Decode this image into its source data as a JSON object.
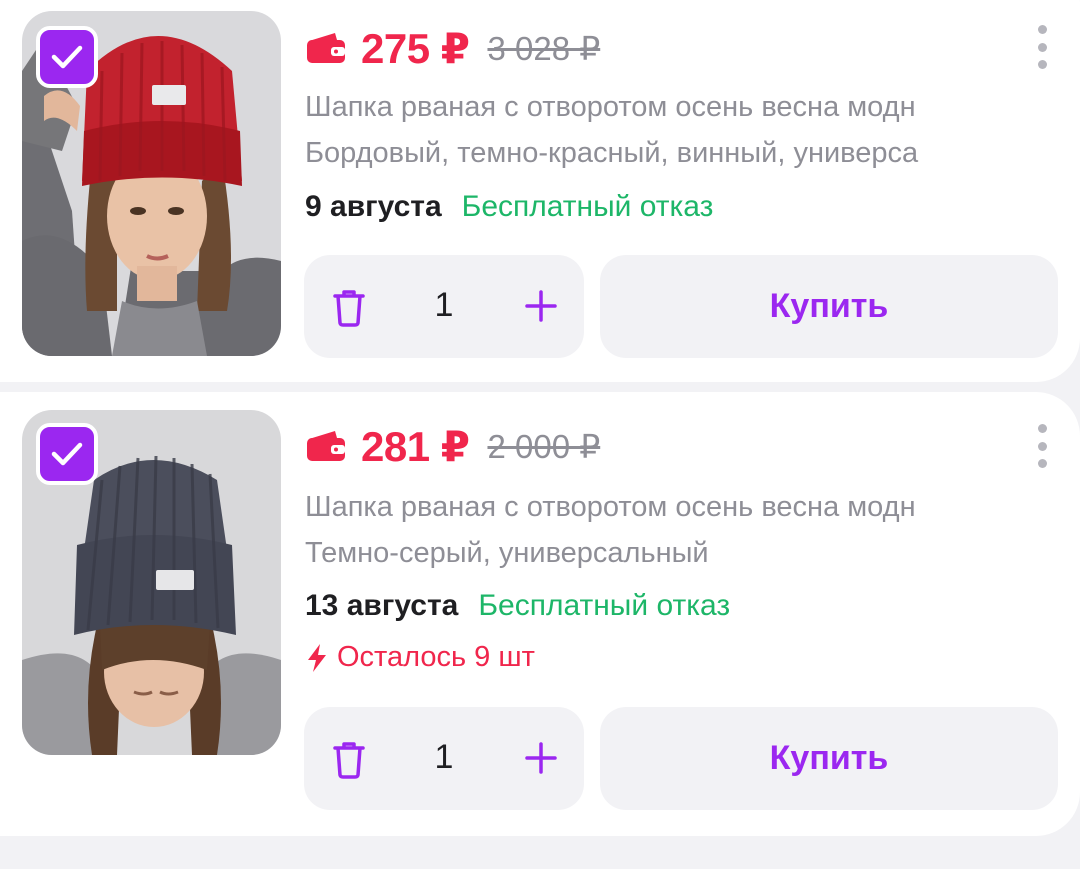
{
  "colors": {
    "accent": "#9b27f0",
    "price": "#f0264c",
    "refund": "#1db668",
    "muted": "#8e8e96"
  },
  "items": [
    {
      "selected": true,
      "image": "red-knit-hat-photo",
      "price": "275 ₽",
      "old_price": "3 028 ₽",
      "title": "Шапка рваная с отворотом осень весна модн",
      "variant": "Бордовый, темно-красный, винный, универса",
      "delivery_date": "9 августа",
      "refund_note": "Бесплатный отказ",
      "quantity": "1",
      "buy_label": "Купить"
    },
    {
      "selected": true,
      "image": "grey-knit-hat-photo",
      "price": "281 ₽",
      "old_price": "2 000 ₽",
      "title": "Шапка рваная с отворотом осень весна модн",
      "variant": "Темно-серый, универсальный",
      "delivery_date": "13 августа",
      "refund_note": "Бесплатный отказ",
      "stock_note": "Осталось 9 шт",
      "quantity": "1",
      "buy_label": "Купить"
    }
  ]
}
